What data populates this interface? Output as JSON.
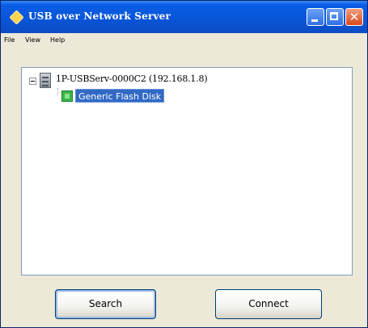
{
  "window": {
    "title": "USB over Network Server"
  },
  "menu": [
    "File",
    "View",
    "Help"
  ],
  "tree": {
    "server": {
      "label": "1P-USBServ-0000C2 (192.168.1.8)"
    },
    "device": {
      "label": "Generic Flash Disk",
      "selected": true
    }
  },
  "buttons": {
    "search": "Search",
    "connect": "Connect"
  },
  "colors": {
    "titlebar": "#0a55d9",
    "selection": "#316ac5",
    "device_icon": "#3ab54a"
  },
  "icons": [
    "app-icon",
    "minimize-icon",
    "maximize-icon",
    "close-icon",
    "expand-collapse-icon",
    "server-device-icon",
    "usb-device-icon"
  ]
}
